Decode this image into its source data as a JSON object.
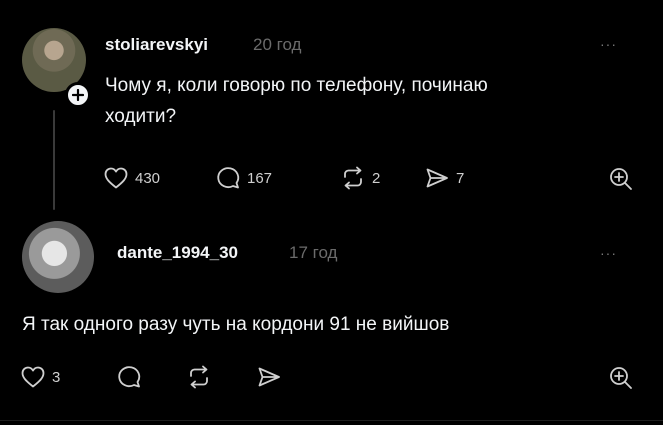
{
  "posts": [
    {
      "username": "stoliarevskyi",
      "time": "20 год",
      "more": "···",
      "text_line1": "Чому я, коли говорю по телефону, починаю",
      "text_line2": "ходити?",
      "likes": "430",
      "comments": "167",
      "reposts": "2",
      "shares": "7"
    },
    {
      "username": "dante_1994_30",
      "time": "17 год",
      "more": "···",
      "text_line1": "Я так одного разу  чуть на кордони 91 не вийшов",
      "likes": "3"
    }
  ],
  "icons": {
    "like": "heart-icon",
    "comment": "comment-bubble-icon",
    "repost": "repost-icon",
    "share": "send-icon",
    "save": "add-search-icon",
    "follow": "plus-icon"
  },
  "colors": {
    "background": "#000000",
    "text": "#f3f5f7",
    "muted": "#6b6b6b",
    "icon": "#cfcfcf"
  }
}
